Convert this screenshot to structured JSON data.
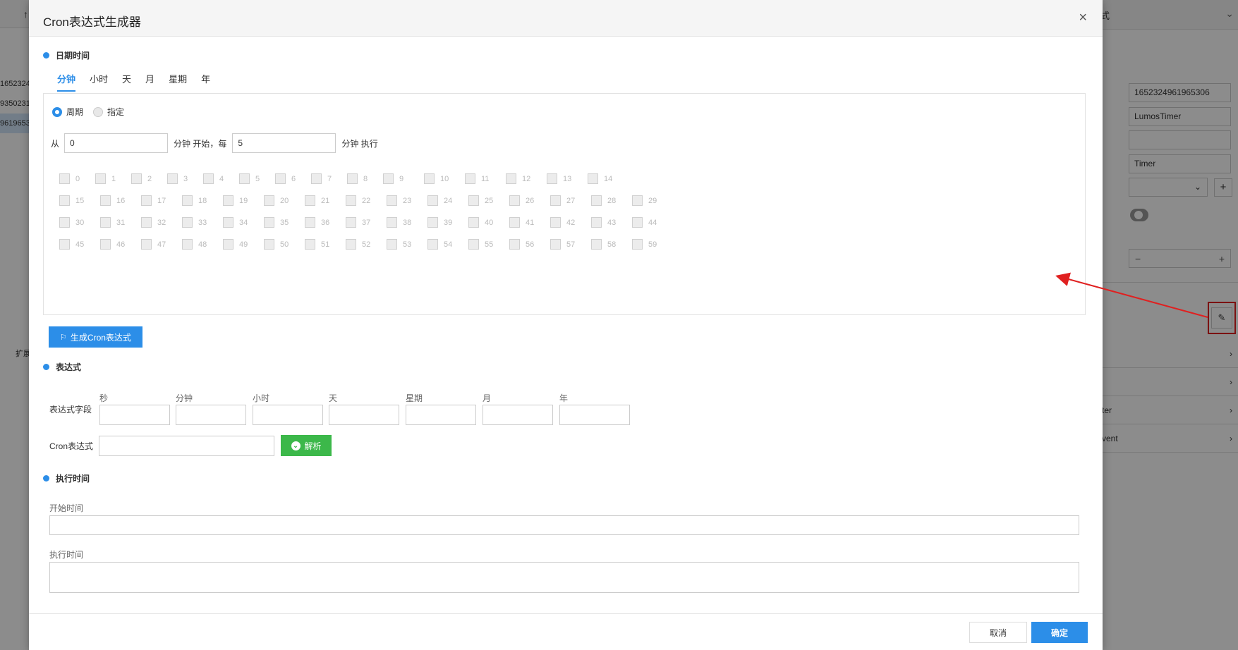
{
  "background": {
    "left_rows": [
      "1652324",
      "9350231",
      "9619653"
    ],
    "left_expand": "扩展",
    "right_header_title": "式",
    "right_fields": [
      "1652324961965306",
      "LumosTimer",
      "",
      "Timer"
    ],
    "right_accordion": [
      "",
      "",
      "ter",
      "vent"
    ]
  },
  "dialog": {
    "title": "Cron表达式生成器",
    "close": "×",
    "datetime_title": "日期时间",
    "tabs": [
      "分钟",
      "小时",
      "天",
      "月",
      "星期",
      "年"
    ],
    "radios": [
      "周期",
      "指定"
    ],
    "cycle": {
      "from_label": "从",
      "from_value": "0",
      "mid_label": "分钟 开始，每",
      "every_value": "5",
      "end_label": "分钟 执行"
    },
    "minutes": [
      [
        "0",
        "1",
        "2",
        "3",
        "4",
        "5",
        "6",
        "7",
        "8",
        "9",
        "10",
        "11",
        "12",
        "13",
        "14"
      ],
      [
        "15",
        "16",
        "17",
        "18",
        "19",
        "20",
        "21",
        "22",
        "23",
        "24",
        "25",
        "26",
        "27",
        "28",
        "29"
      ],
      [
        "30",
        "31",
        "32",
        "33",
        "34",
        "35",
        "36",
        "37",
        "38",
        "39",
        "40",
        "41",
        "42",
        "43",
        "44"
      ],
      [
        "45",
        "46",
        "47",
        "48",
        "49",
        "50",
        "51",
        "52",
        "53",
        "54",
        "55",
        "56",
        "57",
        "58",
        "59"
      ]
    ],
    "generate_button": "生成Cron表达式",
    "expression_title": "表达式",
    "expression_field_label": "表达式字段",
    "expression_fields": [
      "秒",
      "分钟",
      "小时",
      "天",
      "星期",
      "月",
      "年"
    ],
    "cron_label": "Cron表达式",
    "parse_button": "解析",
    "exec_title": "执行时间",
    "start_time_label": "开始时间",
    "exec_time_label": "执行时间",
    "cancel": "取消",
    "ok": "确定"
  },
  "colors": {
    "primary": "#2c8ee8",
    "success": "#3cb84a",
    "annotation": "#e02020"
  }
}
